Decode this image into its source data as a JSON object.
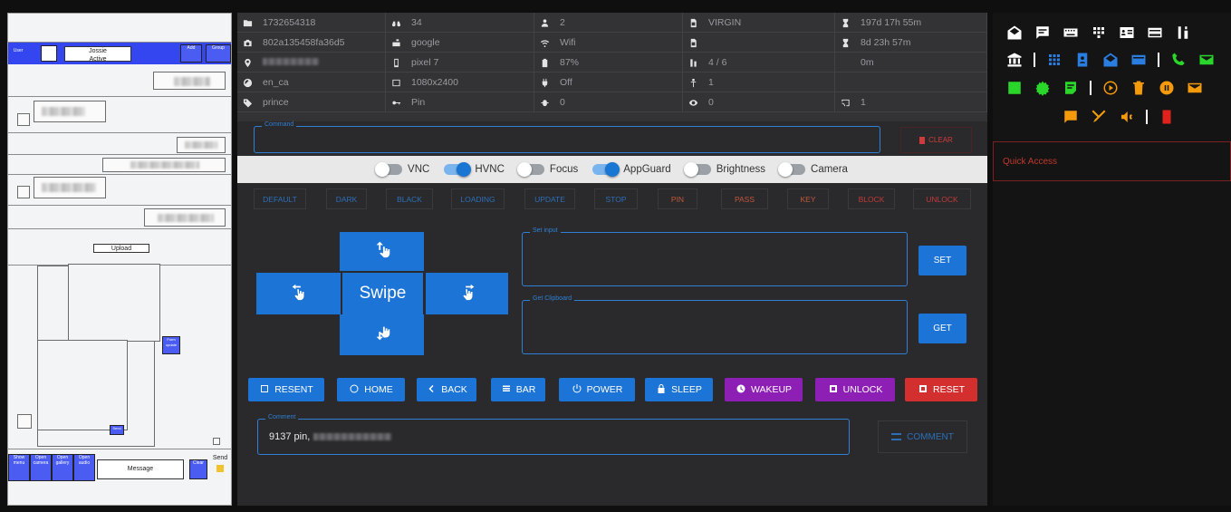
{
  "left_panel": {
    "user_name": "Jossie",
    "user_status": "Active",
    "upload_label": "Upload",
    "blue_btn_a": "Add",
    "blue_btn_b": "Group",
    "map_btn_label": "Form update",
    "small_btn_label": "Send",
    "message_placeholder": "Message",
    "bottom_buttons": [
      "Show menu",
      "Open camera",
      "Open gallery",
      "Open audio"
    ],
    "clear_label": "Clear",
    "send_label": "Send"
  },
  "info_grid": {
    "device_id": "1732654318",
    "device_hash": "802a135458fa36d5",
    "locale": "en_ca",
    "tag": "prince",
    "count_a": "34",
    "account": "google",
    "model": "pixel 7",
    "resolution": "1080x2400",
    "lock_type": "Pin",
    "users": "2",
    "network": "Wifi",
    "battery": "87%",
    "charging": "Off",
    "bugs": "0",
    "carrier": "VIRGIN",
    "perm_ratio": "4 / 6",
    "persons": "1",
    "views": "0",
    "cast_count": "1",
    "uptime": "197d 17h 55m",
    "uptime2": "8d 23h 57m",
    "sleep": "0m"
  },
  "command_label": "Command",
  "clear_button": "CLEAR",
  "toggles": [
    {
      "label": "VNC",
      "on": false
    },
    {
      "label": "HVNC",
      "on": true
    },
    {
      "label": "Focus",
      "on": false
    },
    {
      "label": "AppGuard",
      "on": true
    },
    {
      "label": "Brightness",
      "on": false
    },
    {
      "label": "Camera",
      "on": false
    }
  ],
  "quick_buttons": [
    "DEFAULT",
    "DARK",
    "BLACK",
    "LOADING",
    "UPDATE",
    "STOP",
    "PIN",
    "PASS",
    "KEY",
    "BLOCK",
    "UNLOCK"
  ],
  "swipe_label": "Swipe",
  "set_input_label": "Set input",
  "get_clipboard_label": "Get Clipboard",
  "set_button": "SET",
  "get_button": "GET",
  "action_buttons": [
    "RESENT",
    "HOME",
    "BACK",
    "BAR",
    "POWER",
    "SLEEP",
    "WAKEUP",
    "UNLOCK",
    "RESET"
  ],
  "comment_label": "Comment",
  "comment_value": "9137 pin,",
  "comment_button": "COMMENT",
  "quick_access_label": "Quick Access",
  "colors": {
    "accent": "#1c74d6",
    "purple": "#8e1fb5",
    "danger": "#d32f2f",
    "green": "#2bd62b",
    "orange": "#f59a0b"
  }
}
